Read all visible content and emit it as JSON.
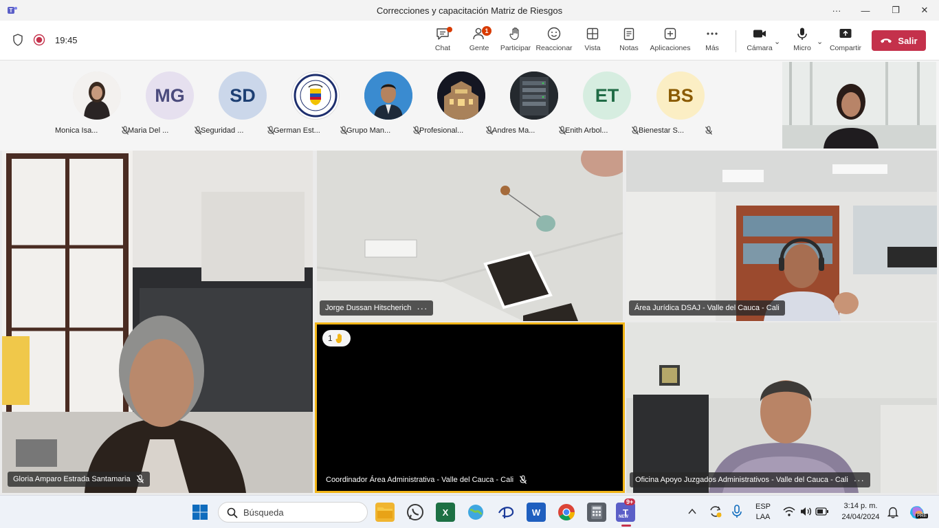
{
  "window": {
    "title": "Correcciones y capacitación Matriz de Riesgos",
    "more": "···",
    "minimize": "—",
    "maximize": "❐",
    "close": "✕"
  },
  "toolbar": {
    "timer": "19:45",
    "buttons": {
      "chat": "Chat",
      "people": "Gente",
      "people_badge": "1",
      "raise": "Participar",
      "react": "Reaccionar",
      "view": "Vista",
      "notes": "Notas",
      "apps": "Aplicaciones",
      "more": "Más",
      "camera": "Cámara",
      "mic": "Micro",
      "share": "Compartir",
      "leave": "Salir"
    },
    "colors": {
      "leave": "#c4314b",
      "badge": "#d83b01"
    }
  },
  "participants": [
    {
      "name": "Monica Isa...",
      "initials": ""
    },
    {
      "name": "Maria Del ...",
      "initials": "MG"
    },
    {
      "name": "Seguridad ...",
      "initials": "SD"
    },
    {
      "name": "German Est...",
      "initials": ""
    },
    {
      "name": "Grupo Man...",
      "initials": ""
    },
    {
      "name": "Profesional...",
      "initials": ""
    },
    {
      "name": "Andres Ma...",
      "initials": ""
    },
    {
      "name": "Enith Arbol...",
      "initials": "ET"
    },
    {
      "name": "Bienestar S...",
      "initials": "BS"
    }
  ],
  "tiles": {
    "gloria": "Gloria Amparo Estrada Santamaria",
    "jorge": "Jorge Dussan Hitscherich",
    "juridica": "Área Jurídica DSAJ - Valle del Cauca - Cali",
    "coordinador": "Coordinador Área Administrativa - Valle del Cauca - Cali",
    "coordinador_hand_count": "1",
    "oficina": "Oficina Apoyo Juzgados Administrativos - Valle del Cauca - Cali",
    "more": "···"
  },
  "taskbar": {
    "search_placeholder": "Búsqueda",
    "teams_badge": "9+",
    "teams_new": "NEW",
    "lang_line1": "ESP",
    "lang_line2": "LAA",
    "time": "3:14 p. m.",
    "date": "24/04/2024",
    "copilot_badge": "PRE"
  }
}
